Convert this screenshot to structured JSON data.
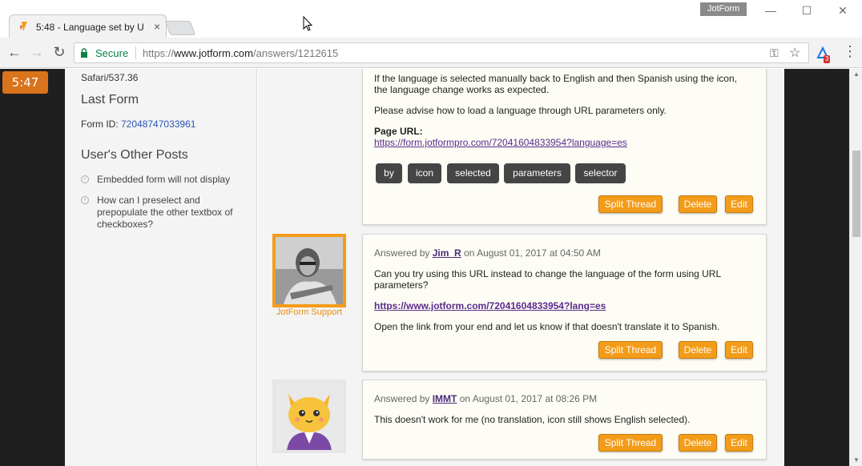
{
  "browser": {
    "tab_title": "5:48 - Language set by U",
    "tab_close": "×",
    "profile": "JotForm",
    "min": "—",
    "max": "☐",
    "close": "✕",
    "secure_label": "Secure",
    "url_scheme": "https://",
    "url_host": "www.jotform.com",
    "url_path": "/answers/1212615",
    "extension_badge": "3"
  },
  "timer": "5:47",
  "sidebar": {
    "ua_fragment": "Safari/537.36",
    "last_form_heading": "Last Form",
    "form_id_label": "Form ID: ",
    "form_id_value": "72048747033961",
    "other_posts_heading": "User's Other Posts",
    "posts": [
      "Embedded form will not display",
      "How can I preselect and prepopulate the other textbox of checkboxes?"
    ]
  },
  "thread": {
    "question": {
      "text_1": "If the language is selected manually back to English and then Spanish using the icon, the language change works as expected.",
      "text_2": "Please advise how to load a language through URL parameters only.",
      "page_url_label": "Page URL:",
      "page_url": "https://form.jotformpro.com/72041604833954?language=es",
      "tags": [
        "by",
        "icon",
        "selected",
        "parameters",
        "selector"
      ],
      "buttons": {
        "split": "Split Thread",
        "delete": "Delete",
        "edit": "Edit"
      }
    },
    "answer_1": {
      "support_label": "JotForm Support",
      "answered_by": "Answered by ",
      "user": "Jim_R",
      "date": " on August 01, 2017 at 04:50 AM",
      "text_1": "Can you try using this URL instead to change the language of the form using URL parameters?",
      "link": "https://www.jotform.com/72041604833954?lang=es",
      "text_2": "Open the link from your end and let us know if that doesn't translate it to Spanish.",
      "buttons": {
        "split": "Split Thread",
        "delete": "Delete",
        "edit": "Edit"
      }
    },
    "answer_2": {
      "answered_by": "Answered by ",
      "user": "IMMT",
      "date": " on August 01, 2017 at 08:26 PM",
      "text_1": "This doesn't work for me (no translation, icon still shows English selected).",
      "buttons": {
        "split": "Split Thread",
        "delete": "Delete",
        "edit": "Edit"
      }
    }
  }
}
